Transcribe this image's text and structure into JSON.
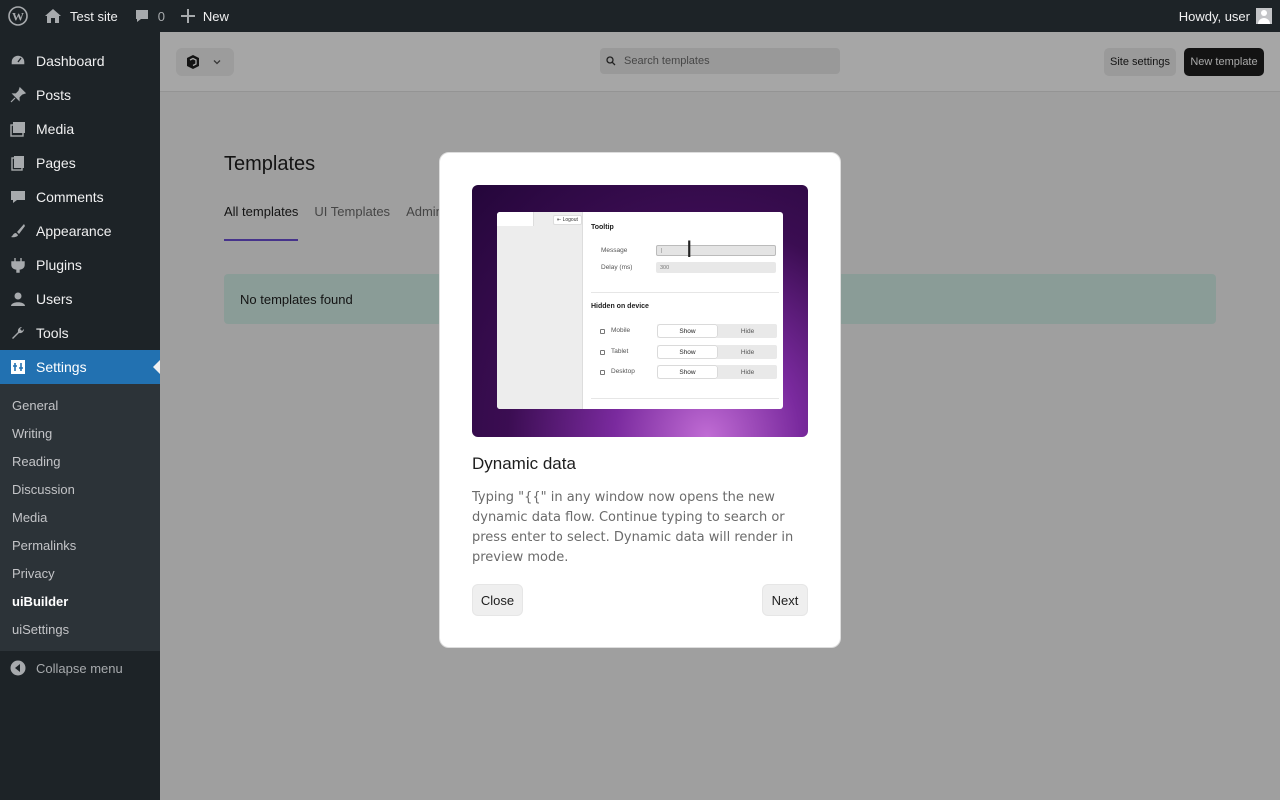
{
  "adminbar": {
    "site_name": "Test site",
    "comments_count": "0",
    "new_label": "New",
    "greeting": "Howdy, user"
  },
  "sidebar": {
    "items": [
      {
        "label": "Dashboard",
        "icon": "dashboard-icon"
      },
      {
        "label": "Posts",
        "icon": "pin-icon"
      },
      {
        "label": "Media",
        "icon": "media-icon"
      },
      {
        "label": "Pages",
        "icon": "pages-icon"
      },
      {
        "label": "Comments",
        "icon": "comment-icon"
      },
      {
        "label": "Appearance",
        "icon": "brush-icon"
      },
      {
        "label": "Plugins",
        "icon": "plugin-icon"
      },
      {
        "label": "Users",
        "icon": "user-icon"
      },
      {
        "label": "Tools",
        "icon": "wrench-icon"
      },
      {
        "label": "Settings",
        "icon": "settings-icon"
      }
    ],
    "submenu": [
      "General",
      "Writing",
      "Reading",
      "Discussion",
      "Media",
      "Permalinks",
      "Privacy",
      "uiBuilder",
      "uiSettings"
    ],
    "collapse_label": "Collapse menu"
  },
  "topbar": {
    "search_placeholder": "Search templates",
    "site_settings_label": "Site settings",
    "new_template_label": "New template"
  },
  "page": {
    "title": "Templates",
    "tabs": [
      "All templates",
      "UI Templates",
      "Admin"
    ],
    "notice": "No templates found"
  },
  "modal": {
    "title": "Dynamic data",
    "body": "Typing \"{{\" in any window now opens the new dynamic data flow. Continue typing to search or press enter to select. Dynamic data will render in preview mode.",
    "close_label": "Close",
    "next_label": "Next",
    "preview": {
      "logout": "Logout",
      "section1": "Tooltip",
      "message_label": "Message",
      "delay_label": "Delay (ms)",
      "delay_value": "300",
      "section2": "Hidden on device",
      "devices": [
        "Mobile",
        "Tablet",
        "Desktop"
      ],
      "show": "Show",
      "hide": "Hide"
    }
  },
  "colors": {
    "admin_dark": "#1d2327",
    "accent_blue": "#2271b1",
    "tab_underline": "#6c4fd6",
    "notice_bg": "#d4f0e8"
  }
}
